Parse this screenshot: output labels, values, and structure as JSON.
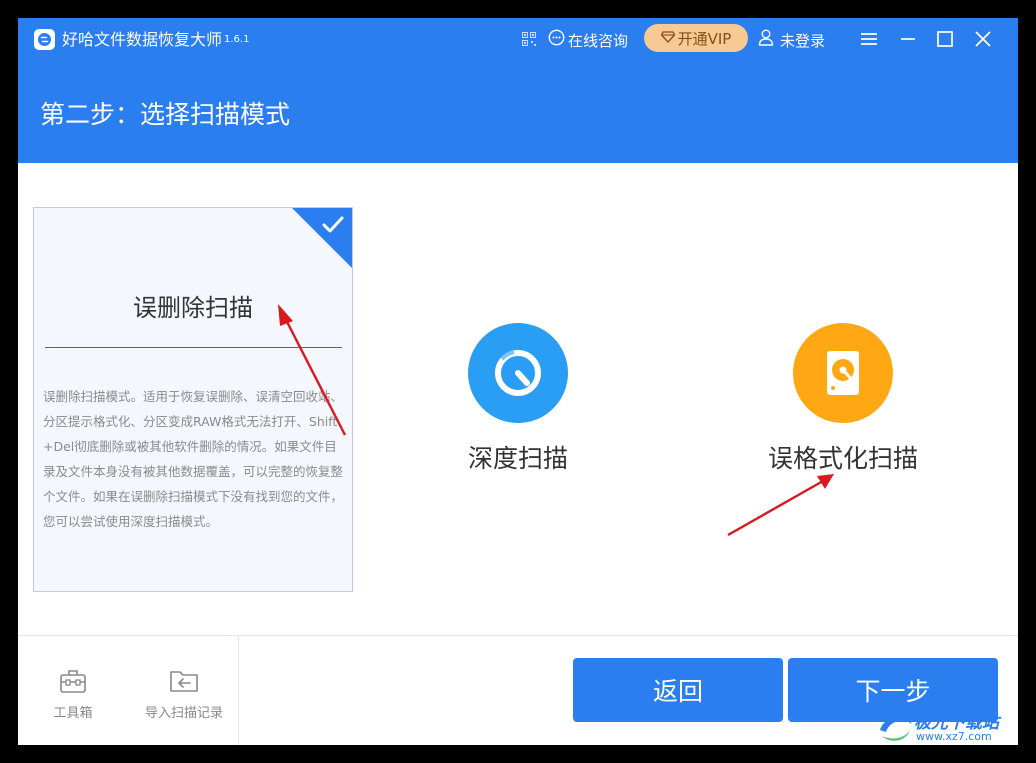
{
  "titlebar": {
    "app_name": "好哈文件数据恢复大师",
    "version": "1.6.1",
    "consult_label": "在线咨询",
    "vip_label": "开通VIP",
    "login_label": "未登录"
  },
  "header": {
    "step_title": "第二步：选择扫描模式"
  },
  "scan_modes": {
    "selected": {
      "title": "误删除扫描",
      "description": "误删除扫描模式。适用于恢复误删除、误清空回收站、分区提示格式化、分区变成RAW格式无法打开、Shift+Del彻底删除或被其他软件删除的情况。如果文件目录及文件本身没有被其他数据覆盖，可以完整的恢复整个文件。如果在误删除扫描模式下没有找到您的文件，您可以尝试使用深度扫描模式。"
    },
    "deep": {
      "label": "深度扫描"
    },
    "format": {
      "label": "误格式化扫描"
    }
  },
  "footer": {
    "toolbox_label": "工具箱",
    "import_label": "导入扫描记录",
    "back_label": "返回",
    "next_label": "下一步"
  },
  "watermark": {
    "line1": "极光下载站",
    "line2": "www.xz7.com"
  },
  "colors": {
    "primary": "#2a7ef0",
    "vip_bg": "#f7c994",
    "deep_icon": "#2a9df4",
    "format_icon": "#ffa814",
    "arrow": "#d9191b"
  }
}
